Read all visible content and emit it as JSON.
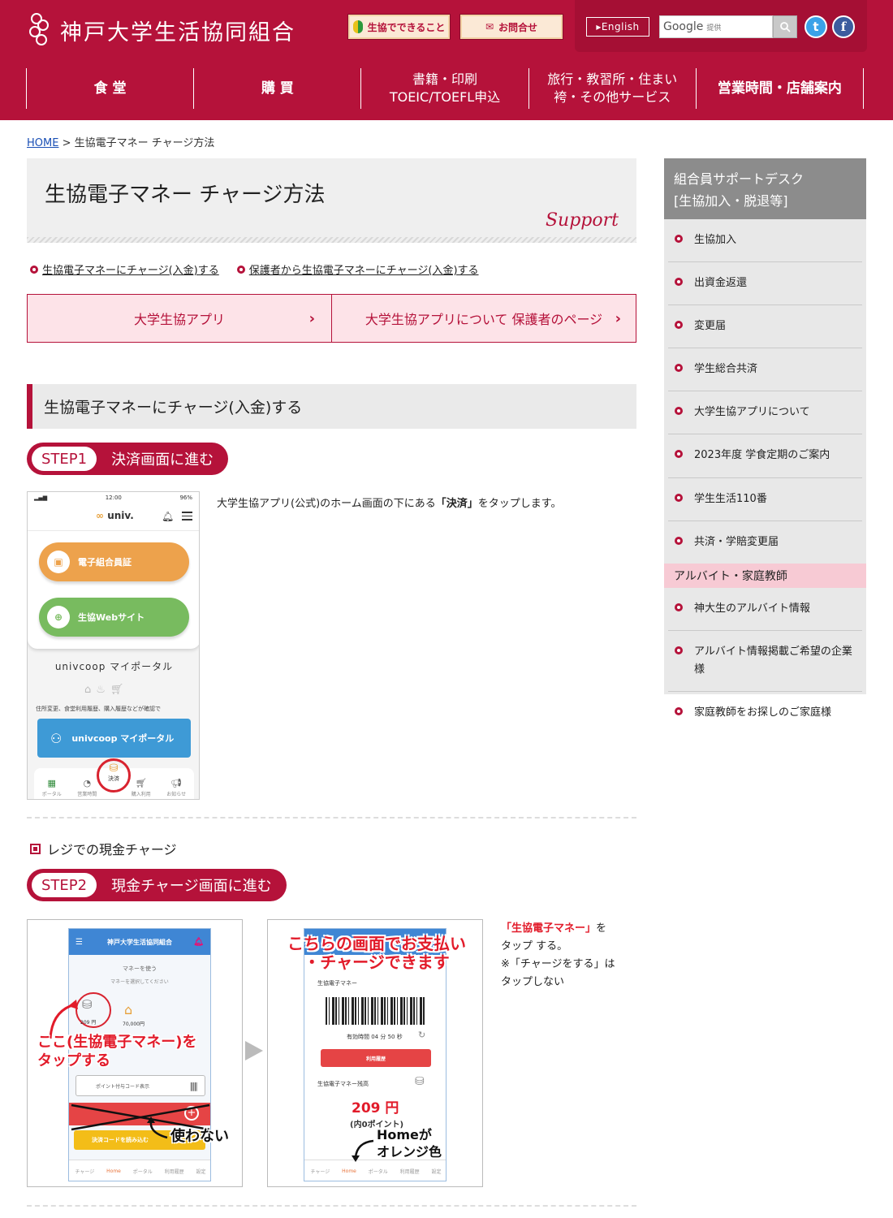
{
  "header": {
    "logo_text": "神戸大学生活協同組合",
    "btn_coop": "生協でできること",
    "btn_contact": "お問合せ",
    "btn_english": "▸English",
    "search_brand": "Google",
    "search_brand_sub": "提供",
    "social_twitter": "t",
    "social_facebook": "f",
    "nav": [
      {
        "label": "食 堂",
        "sub": ""
      },
      {
        "label": "購 買",
        "sub": ""
      },
      {
        "label": "書籍・印刷",
        "sub": "TOEIC/TOEFL申込"
      },
      {
        "label": "旅行・教習所・住まい",
        "sub": "袴・その他サービス"
      },
      {
        "label": "営業時間・店舗案内",
        "sub": ""
      }
    ]
  },
  "breadcrumb": {
    "home": "HOME",
    "sep": " > ",
    "current": "生協電子マネー チャージ方法"
  },
  "title_box": {
    "title": "生協電子マネー チャージ方法",
    "support": "Support"
  },
  "anchor_links": [
    "生協電子マネーにチャージ(入金)する",
    "保護者から生協電子マネーにチャージ(入金)する"
  ],
  "app_buttons": [
    "大学生協アプリ",
    "大学生協アプリについて 保護者のページ"
  ],
  "section_heading": "生協電子マネーにチャージ(入金)する",
  "step1": {
    "num": "STEP1",
    "label": "決済画面に進む",
    "text_before": "大学生協アプリ(公式)のホーム画面の下にある",
    "text_bold": "「決済」",
    "text_after": "をタップします。",
    "phone": {
      "time": "12:00",
      "battery": "96%",
      "logo": "univ.",
      "btn1": "電子組合員証",
      "btn2": "生協Webサイト",
      "portal_title": "univcoop マイポータル",
      "portal_desc": "住所変更、食堂利用履歴、購入履歴などが確認で",
      "portal_btn": "univcoop マイポータル",
      "tabs": [
        "ポータル",
        "営業時間",
        "決済",
        "購入利用",
        "お知らせ"
      ]
    }
  },
  "cash_heading": "レジでの現金チャージ",
  "step2": {
    "num": "STEP2",
    "label": "現金チャージ画面に進む",
    "phoneA": {
      "header": "神戸大学生活協同組合",
      "line1": "マネーを使う",
      "line2": "マネーを選択してください",
      "price1": "209 円",
      "price2": "70,000円",
      "code_btn": "ポイント付与コード表示",
      "yellow_btn": "決済コードを読み込む",
      "tabs": [
        "チャージ",
        "Home",
        "ポータル",
        "利用履歴",
        "設定"
      ],
      "annot_red_1": "ここ(生協電子マネー)を",
      "annot_red_2": "タップする",
      "annot_black": "使わない"
    },
    "phoneB": {
      "title": "生協電子マネー",
      "time": "有効時間 04 分 50 秒",
      "history_btn": "利用履歴",
      "balance_label": "生協電子マネー残高",
      "amount": "209 円",
      "points": "(内0ポイント)",
      "tabs": [
        "チャージ",
        "Home",
        "ポータル",
        "利用履歴",
        "設定"
      ],
      "annot_top_1": "こちらの画面でお支払い",
      "annot_top_2": "・チャージできます",
      "annot_bottom_1": "Homeが",
      "annot_bottom_2": "オレンジ色"
    },
    "text_red": "「生協電子マネー」",
    "text_1": "を",
    "text_2": "タップ する。",
    "text_3": "※「チャージをする」は",
    "text_4": "タップしない"
  },
  "sidebar": {
    "head_1": "組合員サポートデスク",
    "head_2": "[生協加入・脱退等]",
    "items": [
      "生協加入",
      "出資金返還",
      "変更届",
      "学生総合共済",
      "大学生協アプリについて",
      "2023年度 学食定期のご案内",
      "学生生活110番",
      "共済・学賠変更届"
    ],
    "sub_heading": "アルバイト・家庭教師",
    "sub_items": [
      "神大生のアルバイト情報",
      "アルバイト情報掲載ご希望の企業様",
      "家庭教師をお探しのご家庭様"
    ]
  },
  "colors": {
    "brand": "#b5123a",
    "accent_pink": "#fde3e8",
    "sidebar_grey": "#8c8c8c"
  }
}
